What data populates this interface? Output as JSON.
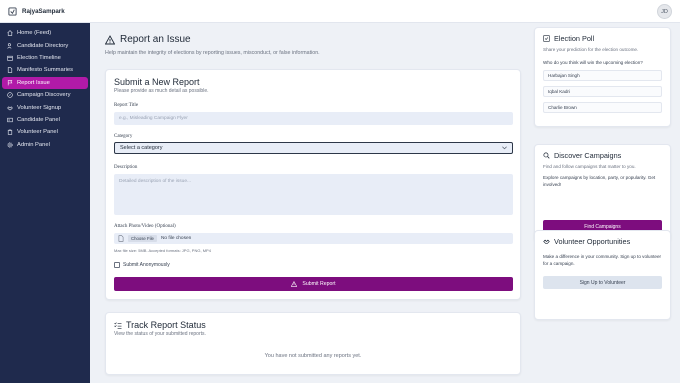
{
  "app": {
    "brand": "RajyaSampark",
    "avatar_initials": "JD"
  },
  "sidebar": {
    "items": [
      {
        "label": "Home (Feed)",
        "icon": "home-icon",
        "active": false
      },
      {
        "label": "Candidate Directory",
        "icon": "users-icon",
        "active": false
      },
      {
        "label": "Election Timeline",
        "icon": "calendar-icon",
        "active": false
      },
      {
        "label": "Manifesto Summaries",
        "icon": "document-icon",
        "active": false
      },
      {
        "label": "Report Issue",
        "icon": "flag-icon",
        "active": true
      },
      {
        "label": "Campaign Discovery",
        "icon": "compass-icon",
        "active": false
      },
      {
        "label": "Volunteer Signup",
        "icon": "handshake-icon",
        "active": false
      },
      {
        "label": "Candidate Panel",
        "icon": "id-card-icon",
        "active": false
      },
      {
        "label": "Volunteer Panel",
        "icon": "clipboard-icon",
        "active": false
      },
      {
        "label": "Admin Panel",
        "icon": "gear-icon",
        "active": false
      }
    ]
  },
  "page": {
    "title": "Report an Issue",
    "subtitle": "Help maintain the integrity of elections by reporting issues, misconduct, or false information."
  },
  "form": {
    "title": "Submit a New Report",
    "subtitle": "Please provide as much detail as possible.",
    "report_title_label": "Report Title",
    "report_title_placeholder": "e.g., Misleading Campaign Flyer",
    "category_label": "Category",
    "category_value": "Select a category",
    "description_label": "Description",
    "description_placeholder": "Detailed description of the issue...",
    "attach_label": "Attach Photo/Video (Optional)",
    "choose_file_label": "Choose File",
    "no_file_text": "No file chosen",
    "file_hint": "Max file size: 5MB. Accepted formats: JPG, PNG, MP4",
    "anonymous_label": "Submit Anonymously",
    "submit_label": "Submit Report"
  },
  "track": {
    "title": "Track Report Status",
    "subtitle": "View the status of your submitted reports.",
    "empty_message": "You have not submitted any reports yet."
  },
  "poll": {
    "title": "Election Poll",
    "subtitle": "Share your prediction for the election outcome.",
    "question": "Who do you think will win the upcoming election?",
    "options": [
      "Harbajan Singh",
      "Iqbal Kadri",
      "Charlie Brown"
    ]
  },
  "discover": {
    "title": "Discover Campaigns",
    "subtitle": "Find and follow campaigns that matter to you.",
    "body": "Explore campaigns by location, party, or popularity. Get involved!",
    "button": "Find Campaigns"
  },
  "volunteer": {
    "title": "Volunteer Opportunities",
    "body": "Make a difference in your community. Sign up to volunteer for a campaign.",
    "button": "Sign Up to Volunteer"
  },
  "colors": {
    "sidebar_bg": "#1f2a4d",
    "active_nav": "#b11aa8",
    "primary_button": "#7d0d7e"
  }
}
